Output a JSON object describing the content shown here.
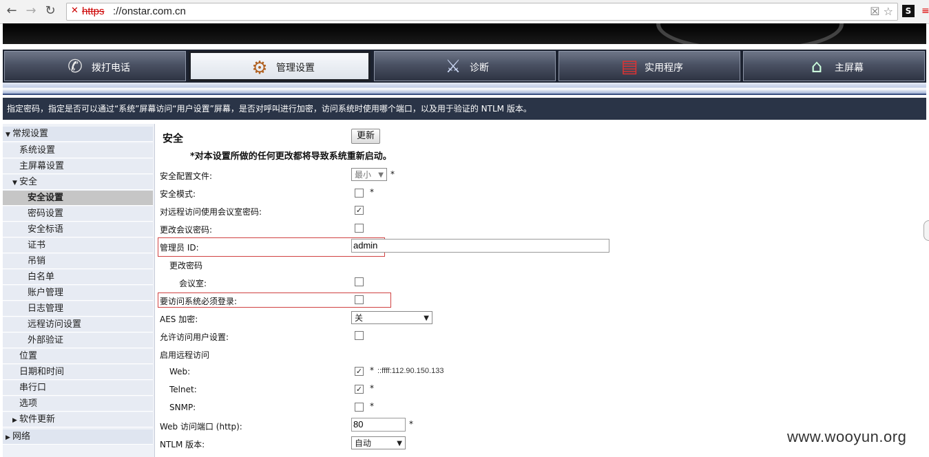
{
  "browser": {
    "url_scheme": "https",
    "url_host": "://onstar.com.cn",
    "ext_label": "S"
  },
  "nav": {
    "tabs": [
      {
        "label": "拨打电话",
        "icon": "phone-icon"
      },
      {
        "label": "管理设置",
        "icon": "admin-settings-icon",
        "active": true
      },
      {
        "label": "诊断",
        "icon": "diagnostics-icon"
      },
      {
        "label": "实用程序",
        "icon": "toolbox-icon"
      },
      {
        "label": "主屏幕",
        "icon": "home-icon"
      }
    ]
  },
  "info_text": "指定密码，指定是否可以通过“系统”屏幕访问“用户设置”屏幕，是否对呼叫进行加密，访问系统时使用哪个端口，以及用于验证的 NTLM 版本。",
  "sidebar": {
    "items": [
      {
        "label": "常规设置",
        "level": 0,
        "arrow": "▼"
      },
      {
        "label": "系统设置",
        "level": 1
      },
      {
        "label": "主屏幕设置",
        "level": 1
      },
      {
        "label": "安全",
        "level": 1,
        "arrow": "▼"
      },
      {
        "label": "安全设置",
        "level": 2,
        "selected": true
      },
      {
        "label": "密码设置",
        "level": 2
      },
      {
        "label": "安全标语",
        "level": 2
      },
      {
        "label": "证书",
        "level": 2
      },
      {
        "label": "吊销",
        "level": 2
      },
      {
        "label": "白名单",
        "level": 2
      },
      {
        "label": "账户管理",
        "level": 2
      },
      {
        "label": "日志管理",
        "level": 2
      },
      {
        "label": "远程访问设置",
        "level": 2
      },
      {
        "label": "外部验证",
        "level": 2
      },
      {
        "label": "位置",
        "level": 1
      },
      {
        "label": "日期和时间",
        "level": 1
      },
      {
        "label": "串行口",
        "level": 1
      },
      {
        "label": "选项",
        "level": 1
      },
      {
        "label": "软件更新",
        "level": 1,
        "arrow": "▶"
      },
      {
        "label": "网络",
        "level": 0,
        "arrow": "▶"
      }
    ]
  },
  "content": {
    "title": "安全",
    "update_label": "更新",
    "warning": "*对本设置所做的任何更改都将导致系统重新启动。",
    "security_profile_label": "安全配置文件:",
    "security_profile_value": "最小",
    "security_mode_label": "安全模式:",
    "meeting_pw_remote_label": "对远程访问使用会议室密码:",
    "change_meeting_pw_label": "更改会议密码:",
    "admin_id_label": "管理员 ID:",
    "admin_id_value": "admin",
    "change_password_label": "更改密码",
    "meeting_room_label": "会议室:",
    "require_login_label": "要访问系统必须登录:",
    "aes_label": "AES 加密:",
    "aes_value": "关",
    "allow_user_settings_label": "允许访问用户设置:",
    "enable_remote_label": "启用远程访问",
    "web_label": "Web:",
    "web_ip": "::ffff:112.90.150.133",
    "telnet_label": "Telnet:",
    "snmp_label": "SNMP:",
    "web_port_label": "Web 访问端口 (http):",
    "web_port_value": "80",
    "ntlm_label": "NTLM 版本:",
    "ntlm_value": "自动",
    "star": "*"
  },
  "watermark": "www.wooyun.org"
}
